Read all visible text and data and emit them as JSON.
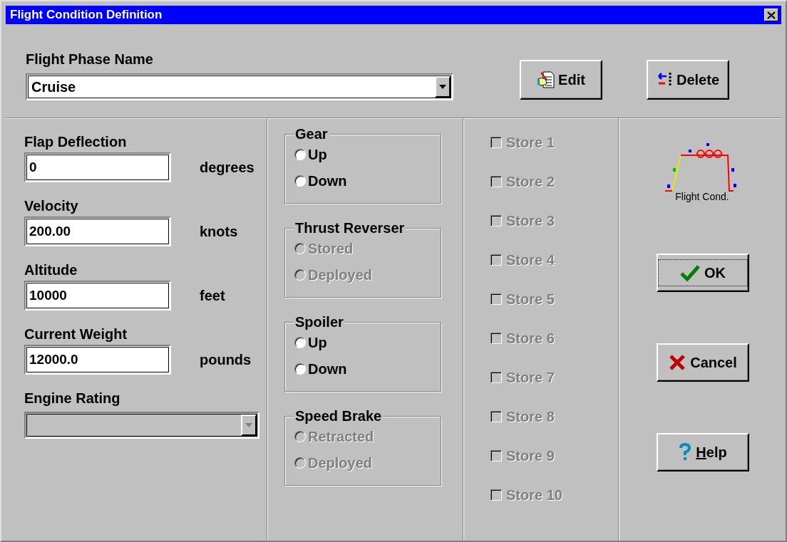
{
  "window": {
    "title": "Flight Condition Definition"
  },
  "phase": {
    "label": "Flight Phase Name",
    "value": "Cruise"
  },
  "top_buttons": [
    {
      "kind": "edit",
      "label": "Edit"
    },
    {
      "kind": "delete",
      "label": "Delete"
    }
  ],
  "fields": [
    {
      "label": "Flap Deflection",
      "value": "0",
      "unit": "degrees"
    },
    {
      "label": "Velocity",
      "value": "200.00",
      "unit": "knots"
    },
    {
      "label": "Altitude",
      "value": "10000",
      "unit": "feet"
    },
    {
      "label": "Current Weight",
      "value": "12000.0",
      "unit": "pounds"
    }
  ],
  "engine_rating": {
    "label": "Engine Rating",
    "disabled": true
  },
  "groups": [
    {
      "title": "Gear",
      "disabled": false,
      "options": [
        {
          "label": "Up",
          "selected": false
        },
        {
          "label": "Down",
          "selected": false
        }
      ]
    },
    {
      "title": "Thrust Reverser",
      "disabled": true,
      "options": [
        {
          "label": "Stored",
          "selected": false
        },
        {
          "label": "Deployed",
          "selected": false
        }
      ]
    },
    {
      "title": "Spoiler",
      "disabled": false,
      "options": [
        {
          "label": "Up",
          "selected": false
        },
        {
          "label": "Down",
          "selected": false
        }
      ]
    },
    {
      "title": "Speed Brake",
      "disabled": true,
      "options": [
        {
          "label": "Retracted",
          "selected": false
        },
        {
          "label": "Deployed",
          "selected": false
        }
      ]
    }
  ],
  "stores": [
    {
      "label": "Store 1",
      "checked": false,
      "disabled": true
    },
    {
      "label": "Store 2",
      "checked": false,
      "disabled": true
    },
    {
      "label": "Store 3",
      "checked": false,
      "disabled": true
    },
    {
      "label": "Store 4",
      "checked": false,
      "disabled": true
    },
    {
      "label": "Store 5",
      "checked": false,
      "disabled": true
    },
    {
      "label": "Store 6",
      "checked": false,
      "disabled": true
    },
    {
      "label": "Store 7",
      "checked": false,
      "disabled": true
    },
    {
      "label": "Store 8",
      "checked": false,
      "disabled": true
    },
    {
      "label": "Store 9",
      "checked": false,
      "disabled": true
    },
    {
      "label": "Store 10",
      "checked": false,
      "disabled": true
    }
  ],
  "diagram_caption": "Flight Cond.",
  "side_buttons": [
    {
      "kind": "ok",
      "label": "OK",
      "default": true,
      "underline_first": false
    },
    {
      "kind": "cancel",
      "label": "Cancel",
      "default": false,
      "underline_first": false
    },
    {
      "kind": "help",
      "label": "Help",
      "default": false,
      "underline_first": true
    }
  ]
}
